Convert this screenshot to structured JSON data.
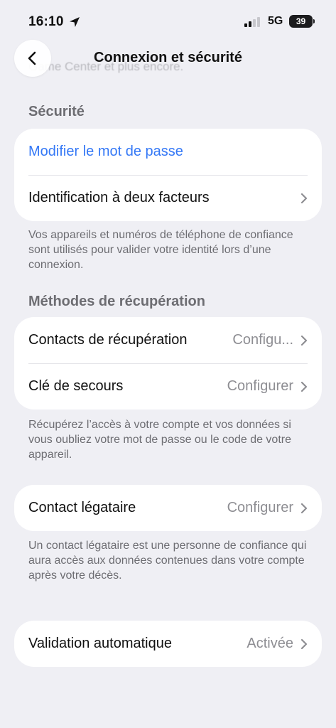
{
  "status_bar": {
    "time": "16:10",
    "network": "5G",
    "battery_percent": "39",
    "icons": [
      "location-arrow-icon",
      "cellular-signal-icon",
      "battery-icon"
    ]
  },
  "underlying_text": "Game Center et plus encore.",
  "nav": {
    "back_icon": "chevron-left-icon",
    "title": "Connexion et sécurité"
  },
  "security": {
    "header": "Sécurité",
    "change_password": "Modifier le mot de passe",
    "two_factor": "Identification à deux facteurs",
    "footnote": "Vos appareils et numéros de téléphone de confiance sont utilisés pour valider votre identité lors d’une connexion."
  },
  "recovery": {
    "header": "Méthodes de récupération",
    "contacts_label": "Contacts de récupération",
    "contacts_value": "Configu...",
    "key_label": "Clé de secours",
    "key_value": "Configurer",
    "footnote": "Récupérez l’accès à votre compte et vos données si vous oubliez votre mot de passe ou le code de votre appareil."
  },
  "legacy": {
    "label": "Contact légataire",
    "value": "Configurer",
    "footnote": "Un contact légataire est une personne de confiance qui aura accès aux données contenues dans votre compte après votre décès."
  },
  "auto_validation": {
    "label": "Validation automatique",
    "value": "Activée"
  },
  "colors": {
    "background": "#efeff4",
    "card": "#ffffff",
    "link": "#3478f6",
    "secondary_text": "#6d6d72",
    "value_text": "#8e8e93"
  }
}
